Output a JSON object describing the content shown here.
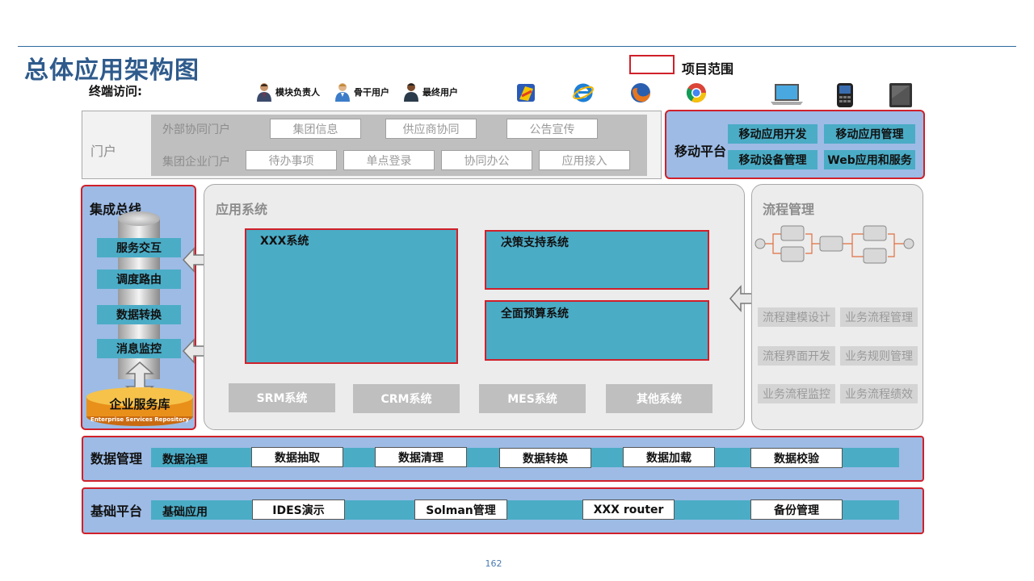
{
  "title": "总体应用架构图",
  "legend": {
    "label": "项目范围",
    "color": "#d0202a"
  },
  "terminal": {
    "label": "终端访问:",
    "users": [
      {
        "label": "模块负责人",
        "icon": "manager-user-icon"
      },
      {
        "label": "骨干用户",
        "icon": "key-user-icon"
      },
      {
        "label": "最终用户",
        "icon": "end-user-icon"
      }
    ],
    "devices": [
      "browser-icon",
      "ie-browser-icon",
      "firefox-icon",
      "chrome-icon",
      "laptop-icon",
      "mobile-phone-icon",
      "tablet-icon"
    ]
  },
  "portal": {
    "label": "门户",
    "rows": [
      {
        "label": "外部协同门户",
        "buttons": [
          "集团信息",
          "供应商协同",
          "公告宣传"
        ]
      },
      {
        "label": "集团企业门户",
        "buttons": [
          "待办事项",
          "单点登录",
          "协同办公",
          "应用接入"
        ]
      }
    ]
  },
  "mobile": {
    "label": "移动平台",
    "items": [
      "移动应用开发",
      "移动应用管理",
      "移动设备管理",
      "Web应用和服务"
    ]
  },
  "bus": {
    "label": "集成总线",
    "items": [
      "服务交互",
      "调度路由",
      "数据转换",
      "消息监控"
    ],
    "repository": "企业服务库",
    "repository_en": "Enterprise Services Repository"
  },
  "app": {
    "label": "应用系统",
    "core_systems": [
      "XXX系统",
      "决策支持系统",
      "全面预算系统"
    ],
    "other_systems": [
      "SRM系统",
      "CRM系统",
      "MES系统",
      "其他系统"
    ]
  },
  "process": {
    "label": "流程管理",
    "items": [
      "流程建模设计",
      "业务流程管理",
      "流程界面开发",
      "业务规则管理",
      "业务流程监控",
      "业务流程绩效"
    ]
  },
  "data_mgmt": {
    "label": "数据管理",
    "items": [
      "数据治理",
      "数据抽取",
      "数据清理",
      "数据转换",
      "数据加载",
      "数据校验"
    ]
  },
  "base": {
    "label": "基础平台",
    "items": [
      "基础应用",
      "IDES演示",
      "Solman管理",
      "XXX router",
      "备份管理"
    ]
  },
  "page_number": "162",
  "colors": {
    "accent_blue": "#4bacc6",
    "panel_blue": "#9dbbe5",
    "title_blue": "#2f5b8c",
    "scope_red": "#d0202a"
  }
}
